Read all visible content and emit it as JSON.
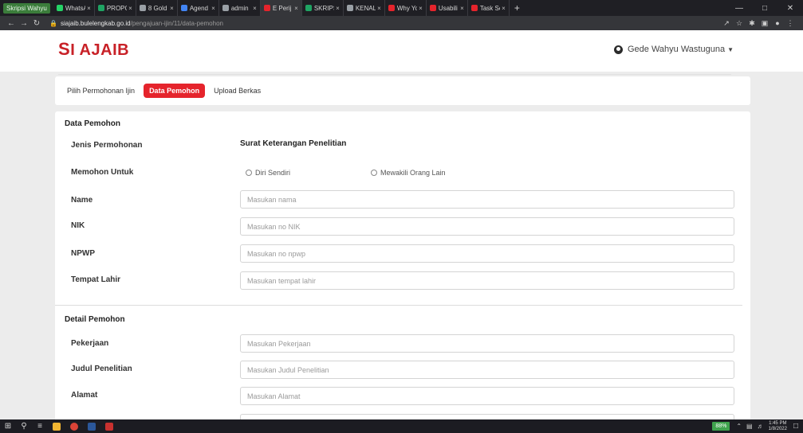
{
  "browser": {
    "profile_label": "Skripsi Wahyu",
    "tabs": [
      {
        "title": "WhatsA",
        "color": "#25d366"
      },
      {
        "title": "PROPO",
        "color": "#1fa463"
      },
      {
        "title": "8 Gold",
        "color": "#9aa0a6"
      },
      {
        "title": "Agend",
        "color": "#4285f4"
      },
      {
        "title": "admin",
        "color": "#9aa0a6"
      },
      {
        "title": "E Perij",
        "color": "#e5242c"
      },
      {
        "title": "SKRIPS",
        "color": "#1fa463"
      },
      {
        "title": "KENAL",
        "color": "#9aa0a6"
      },
      {
        "title": "Why Yo",
        "color": "#e5242c"
      },
      {
        "title": "Usabili",
        "color": "#e5242c"
      },
      {
        "title": "Task Sc",
        "color": "#e5242c"
      }
    ],
    "new_tab": "+",
    "url_host": "siajaib.bulelengkab.go.id",
    "url_path": "/pengajuan-ijin/11/data-pemohon"
  },
  "header": {
    "logo_mark": "S",
    "logo_text": "I AJAIB",
    "user_name": "Gede Wahyu Wastuguna"
  },
  "steps": [
    {
      "label": "Pilih Permohonan Ijin",
      "active": false
    },
    {
      "label": "Data Pemohon",
      "active": true
    },
    {
      "label": "Upload Berkas",
      "active": false
    }
  ],
  "sections": {
    "data_pemohon": "Data Pemohon",
    "detail_pemohon": "Detail Pemohon"
  },
  "form": {
    "jenis_label": "Jenis Permohonan",
    "jenis_value": "Surat Keterangan Penelitian",
    "memohon_label": "Memohon Untuk",
    "radio_self": "Diri Sendiri",
    "radio_other": "Mewakili Orang Lain",
    "name_label": "Name",
    "name_placeholder": "Masukan nama",
    "nik_label": "NIK",
    "nik_placeholder": "Masukan no NIK",
    "npwp_label": "NPWP",
    "npwp_placeholder": "Masukan no npwp",
    "tempat_label": "Tempat Lahir",
    "tempat_placeholder": "Masukan tempat lahir",
    "pekerjaan_label": "Pekerjaan",
    "pekerjaan_placeholder": "Masukan Pekerjaan",
    "judul_label": "Judul Penelitian",
    "judul_placeholder": "Masukan Judul Penelitian",
    "alamat_label": "Alamat",
    "alamat_placeholder": "Masukan Alamat"
  },
  "taskbar": {
    "battery": "88%",
    "time": "1:45 PM",
    "date": "1/8/2022"
  },
  "colors": {
    "brand_red": "#e5242c",
    "logo_red": "#c82127"
  }
}
